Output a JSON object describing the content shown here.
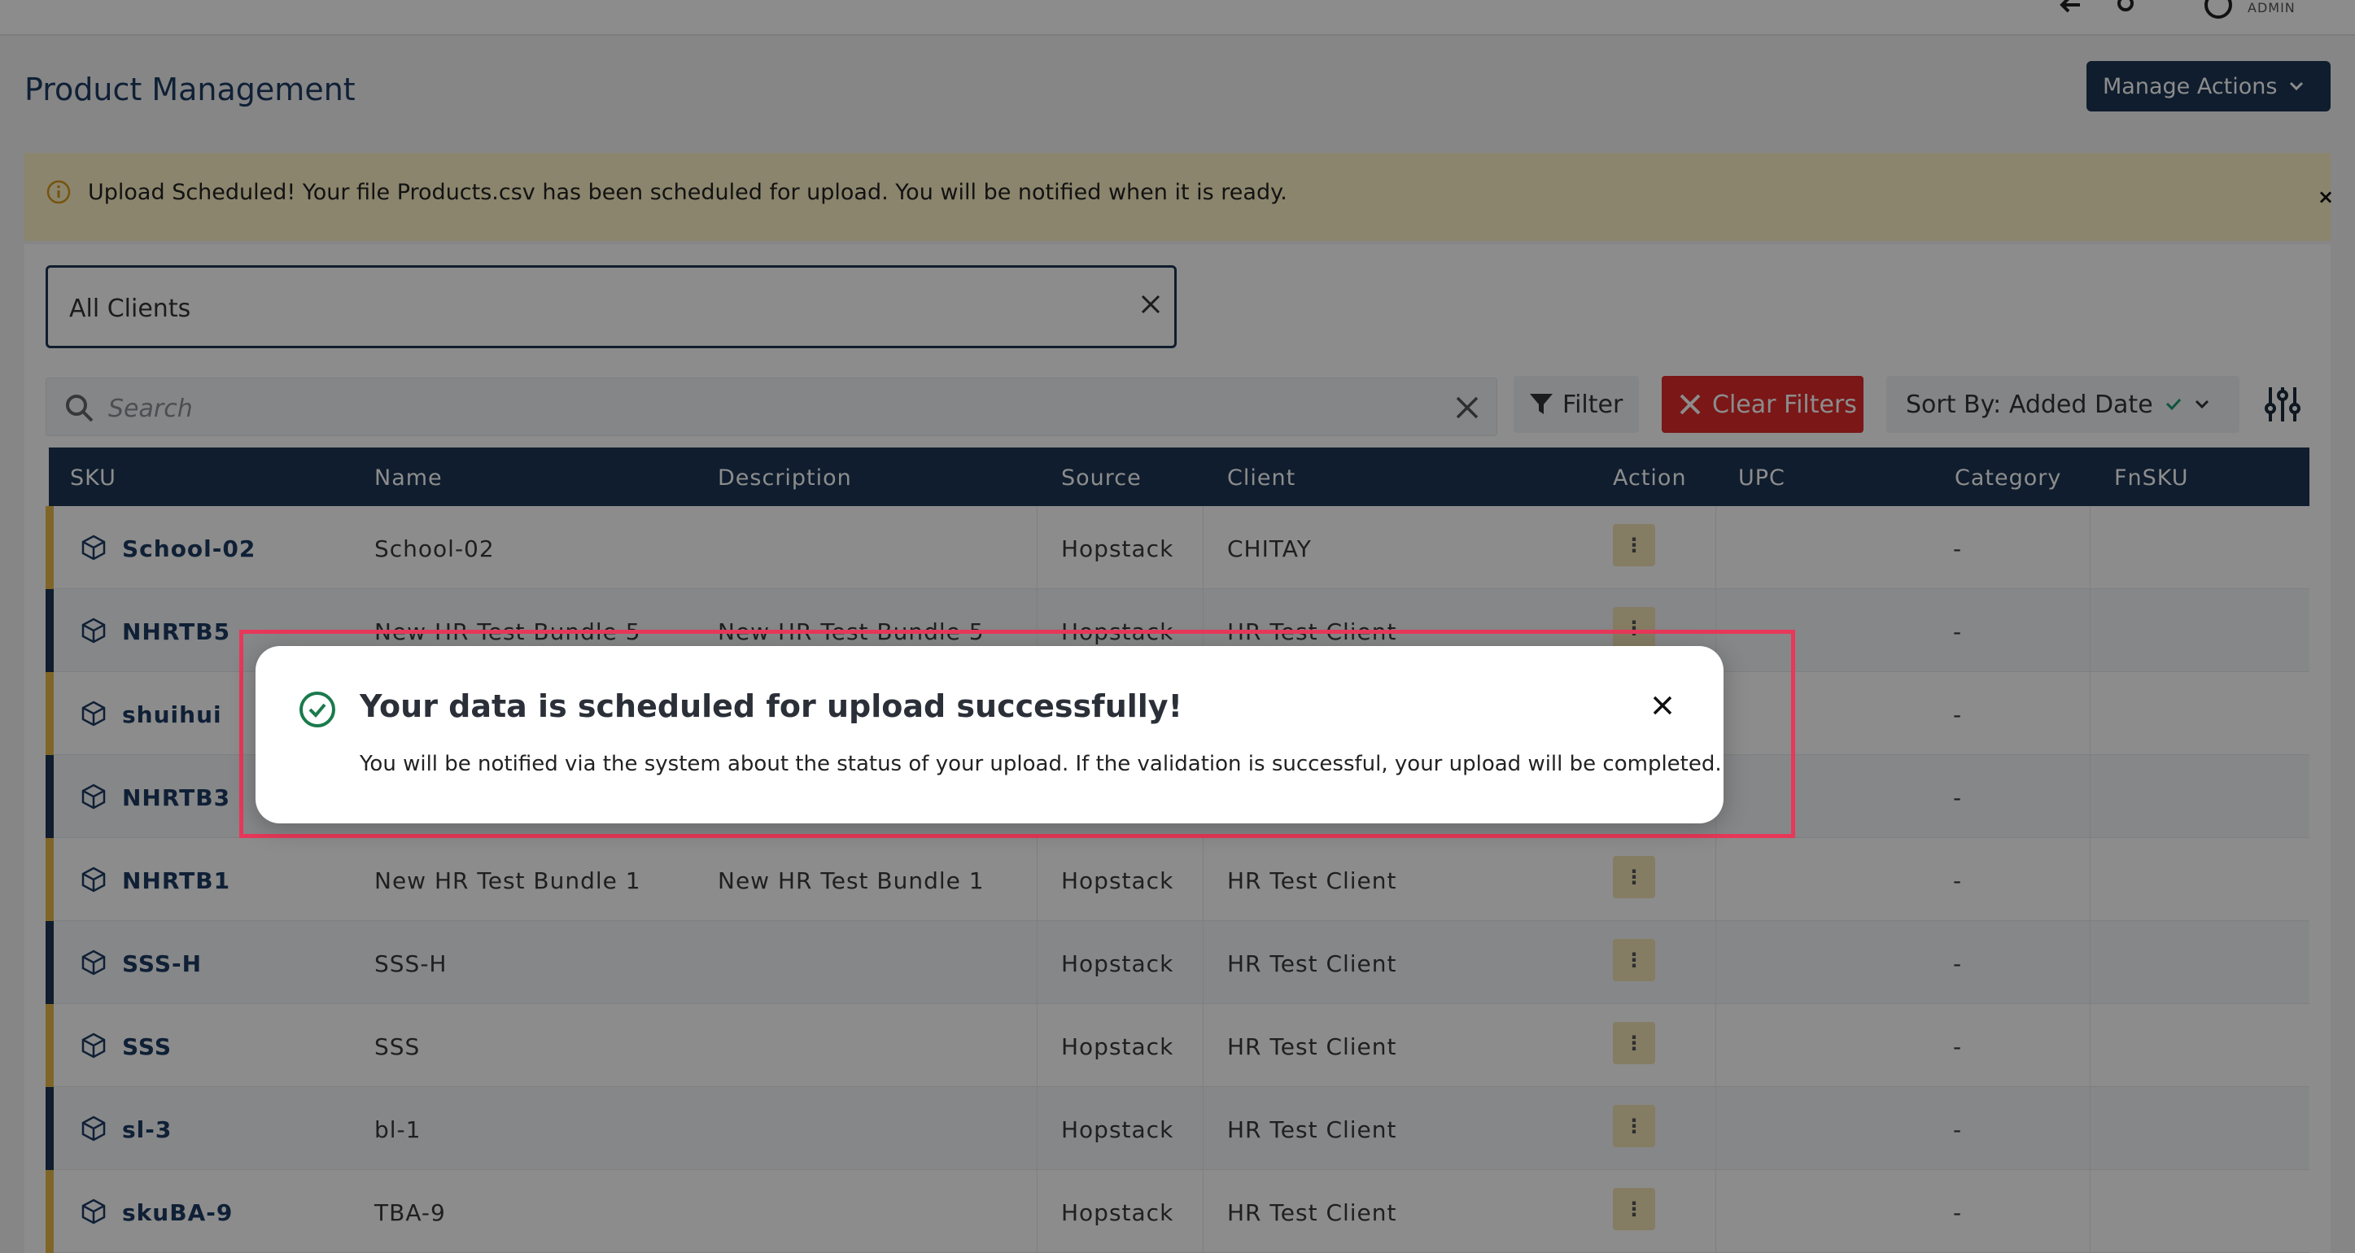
{
  "topbar": {
    "role_label": "ADMIN"
  },
  "page": {
    "title": "Product Management"
  },
  "manage_actions": {
    "label": "Manage Actions"
  },
  "alert": {
    "text": "Upload Scheduled! Your file Products.csv has been scheduled for upload. You will be notified when it is ready.",
    "close": "×"
  },
  "client_select": {
    "value": "All Clients"
  },
  "search": {
    "placeholder": "Search"
  },
  "toolbar": {
    "filter_label": "Filter",
    "clear_filters_label": "Clear Filters",
    "sort_label": "Sort By: Added Date"
  },
  "table": {
    "columns": [
      "SKU",
      "Name",
      "Description",
      "Source",
      "Client",
      "Action",
      "UPC",
      "Category",
      "FnSKU"
    ],
    "rows": [
      {
        "sku": "School-02",
        "name": "School-02",
        "description": "",
        "source": "Hopstack",
        "client": "CHITAY",
        "upc": "",
        "category": "-",
        "fnsku": ""
      },
      {
        "sku": "NHRTB5",
        "name": "New HR Test Bundle 5",
        "description": "New HR Test Bundle 5",
        "source": "Hopstack",
        "client": "HR Test Client",
        "upc": "",
        "category": "-",
        "fnsku": ""
      },
      {
        "sku": "shuihui",
        "name": "",
        "description": "",
        "source": "",
        "client": "",
        "upc": "",
        "category": "-",
        "fnsku": ""
      },
      {
        "sku": "NHRTB3",
        "name": "",
        "description": "",
        "source": "",
        "client": "",
        "upc": "",
        "category": "-",
        "fnsku": ""
      },
      {
        "sku": "NHRTB1",
        "name": "New HR Test Bundle 1",
        "description": "New HR Test Bundle 1",
        "source": "Hopstack",
        "client": "HR Test Client",
        "upc": "",
        "category": "-",
        "fnsku": ""
      },
      {
        "sku": "SSS-H",
        "name": "SSS-H",
        "description": "",
        "source": "Hopstack",
        "client": "HR Test Client",
        "upc": "",
        "category": "-",
        "fnsku": ""
      },
      {
        "sku": "SSS",
        "name": "SSS",
        "description": "",
        "source": "Hopstack",
        "client": "HR Test Client",
        "upc": "",
        "category": "-",
        "fnsku": ""
      },
      {
        "sku": "sl-3",
        "name": "bl-1",
        "description": "",
        "source": "Hopstack",
        "client": "HR Test Client",
        "upc": "",
        "category": "-",
        "fnsku": ""
      },
      {
        "sku": "skuBA-9",
        "name": "TBA-9",
        "description": "",
        "source": "Hopstack",
        "client": "HR Test Client",
        "upc": "",
        "category": "-",
        "fnsku": ""
      }
    ],
    "action_glyph": "⋮"
  },
  "modal": {
    "title": "Your data is scheduled for upload successfully!",
    "message": "You will be notified via the system about the status of your upload. If the validation is successful, your upload will be completed."
  },
  "colors": {
    "navy": "#1c3654",
    "accent_gold": "#e8b84a",
    "danger": "#e02b2b",
    "highlight": "#e8385a",
    "success": "#1a7a4c"
  },
  "icons": [
    "back-arrow-icon",
    "gear-icon",
    "power-icon",
    "info-icon",
    "close-icon",
    "search-icon",
    "filter-icon",
    "chevron-down-icon",
    "sliders-icon",
    "box-icon",
    "kebab-icon",
    "check-circle-icon"
  ]
}
